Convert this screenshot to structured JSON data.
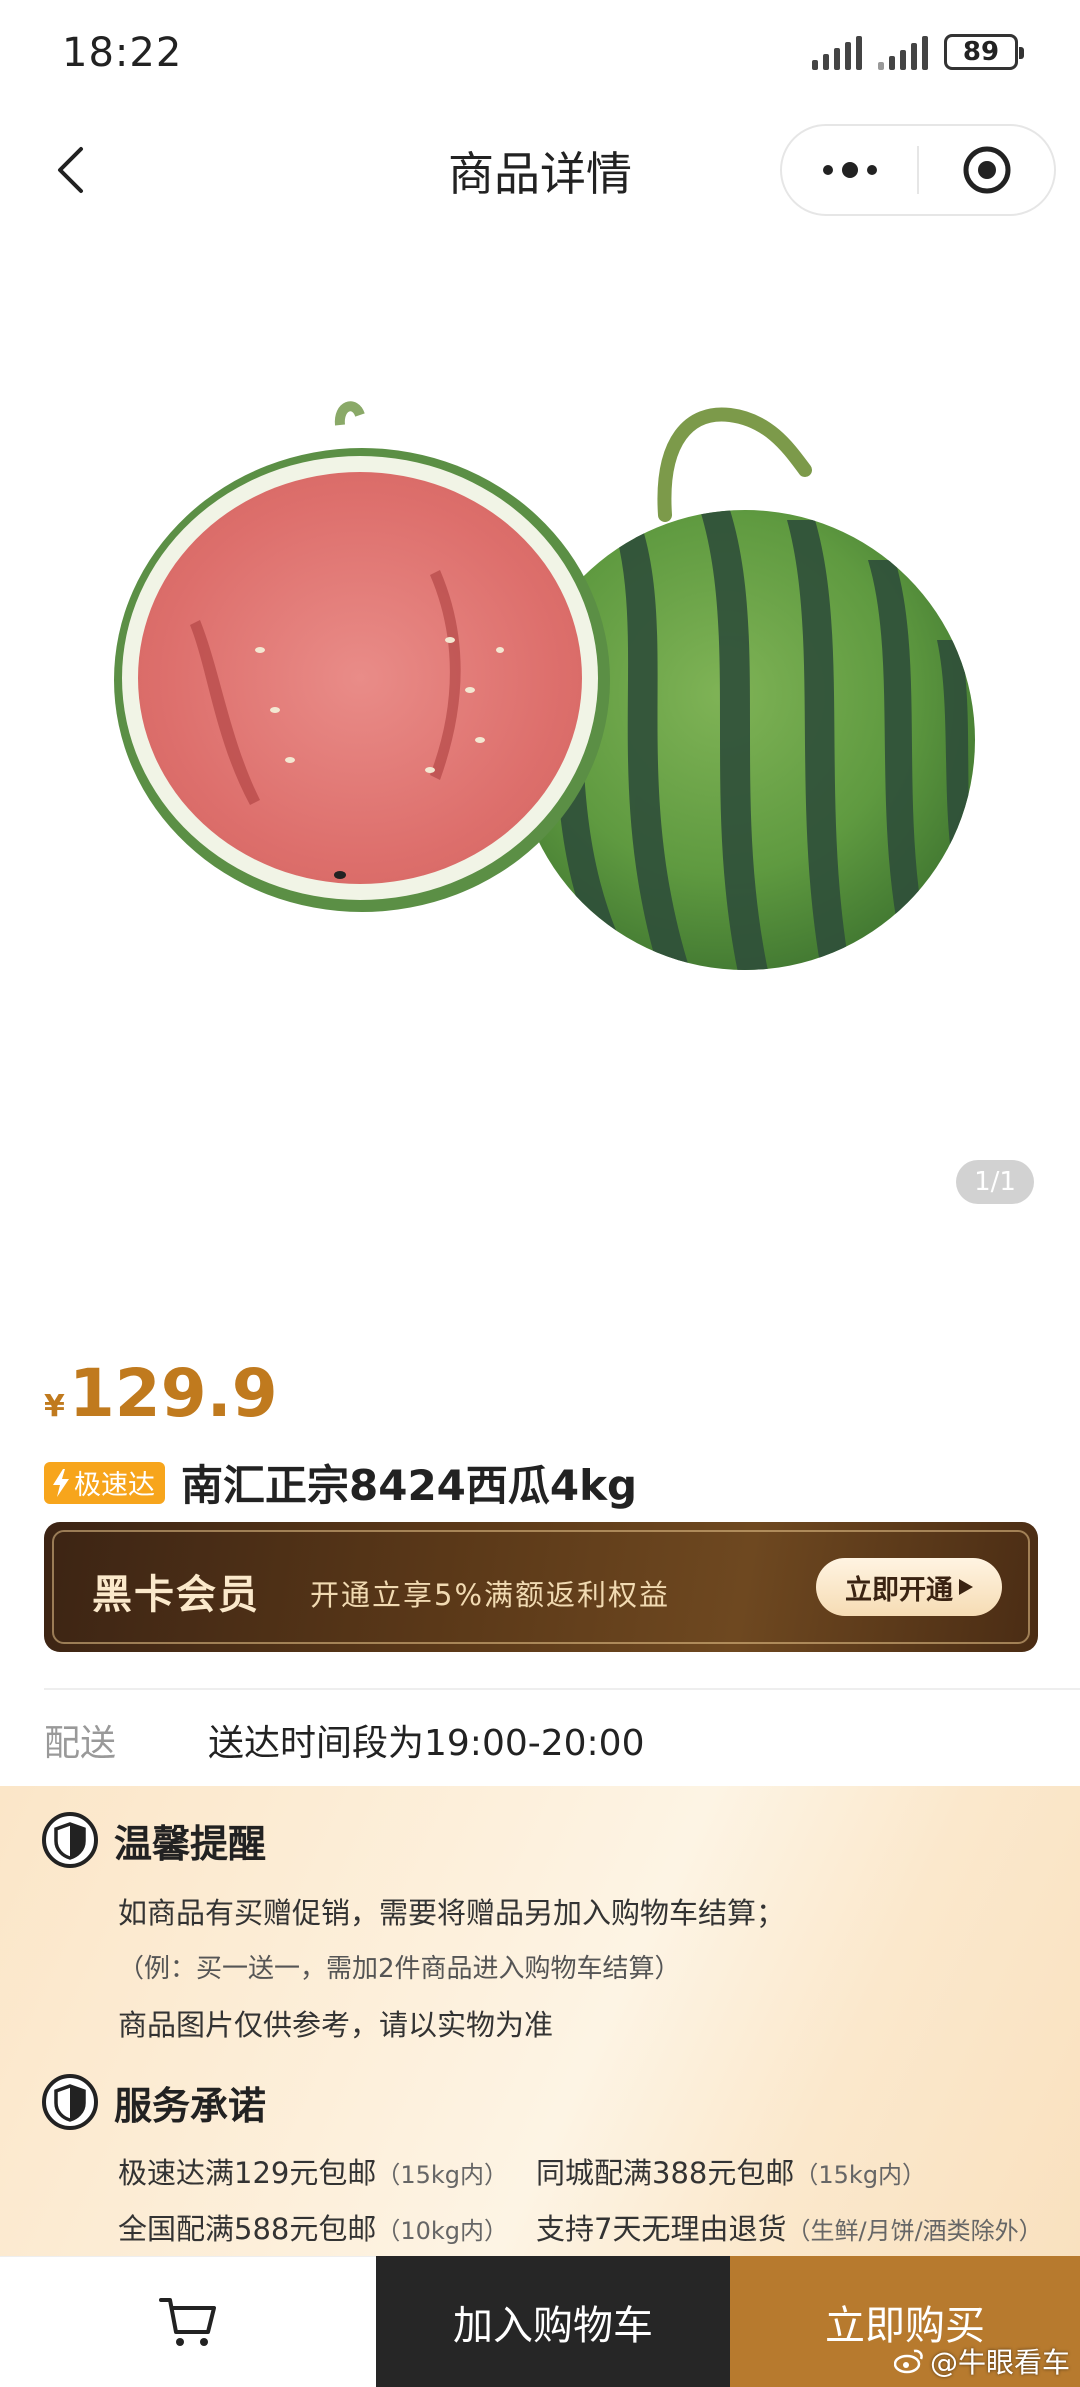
{
  "status_bar": {
    "time": "18:22",
    "battery": "89"
  },
  "nav": {
    "title": "商品详情"
  },
  "gallery": {
    "indicator": "1/1"
  },
  "product": {
    "currency": "¥",
    "price": "129.9",
    "badge": "极速达",
    "title": "南汇正宗8424西瓜4kg"
  },
  "vip_banner": {
    "title": "黑卡会员",
    "description": "开通立享5%满额返利权益",
    "button": "立即开通"
  },
  "delivery": {
    "label": "配送",
    "text": "送达时间段为19:00-20:00"
  },
  "notice": {
    "reminder_title": "温馨提醒",
    "reminder_line1": "如商品有买赠促销，需要将赠品另加入购物车结算；",
    "reminder_line2": "（例：买一送一，需加2件商品进入购物车结算）",
    "reminder_line3": "商品图片仅供参考，请以实物为准",
    "service_title": "服务承诺",
    "services": [
      {
        "main": "极速达满129元包邮",
        "note": "（15kg内）"
      },
      {
        "main": "同城配满388元包邮",
        "note": "（15kg内）"
      },
      {
        "main": "全国配满588元包邮",
        "note": "（10kg内）"
      },
      {
        "main": "支持7天无理由退货",
        "note": "（生鲜/月饼/酒类除外）"
      }
    ]
  },
  "bottom_bar": {
    "add_to_cart": "加入购物车",
    "buy_now": "立即购买"
  },
  "watermark": "@牛眼看车",
  "colors": {
    "price": "#c07a1e",
    "badge": "#f7a51c",
    "buy_now": "#b77a2e",
    "add_to_cart": "#262626"
  }
}
